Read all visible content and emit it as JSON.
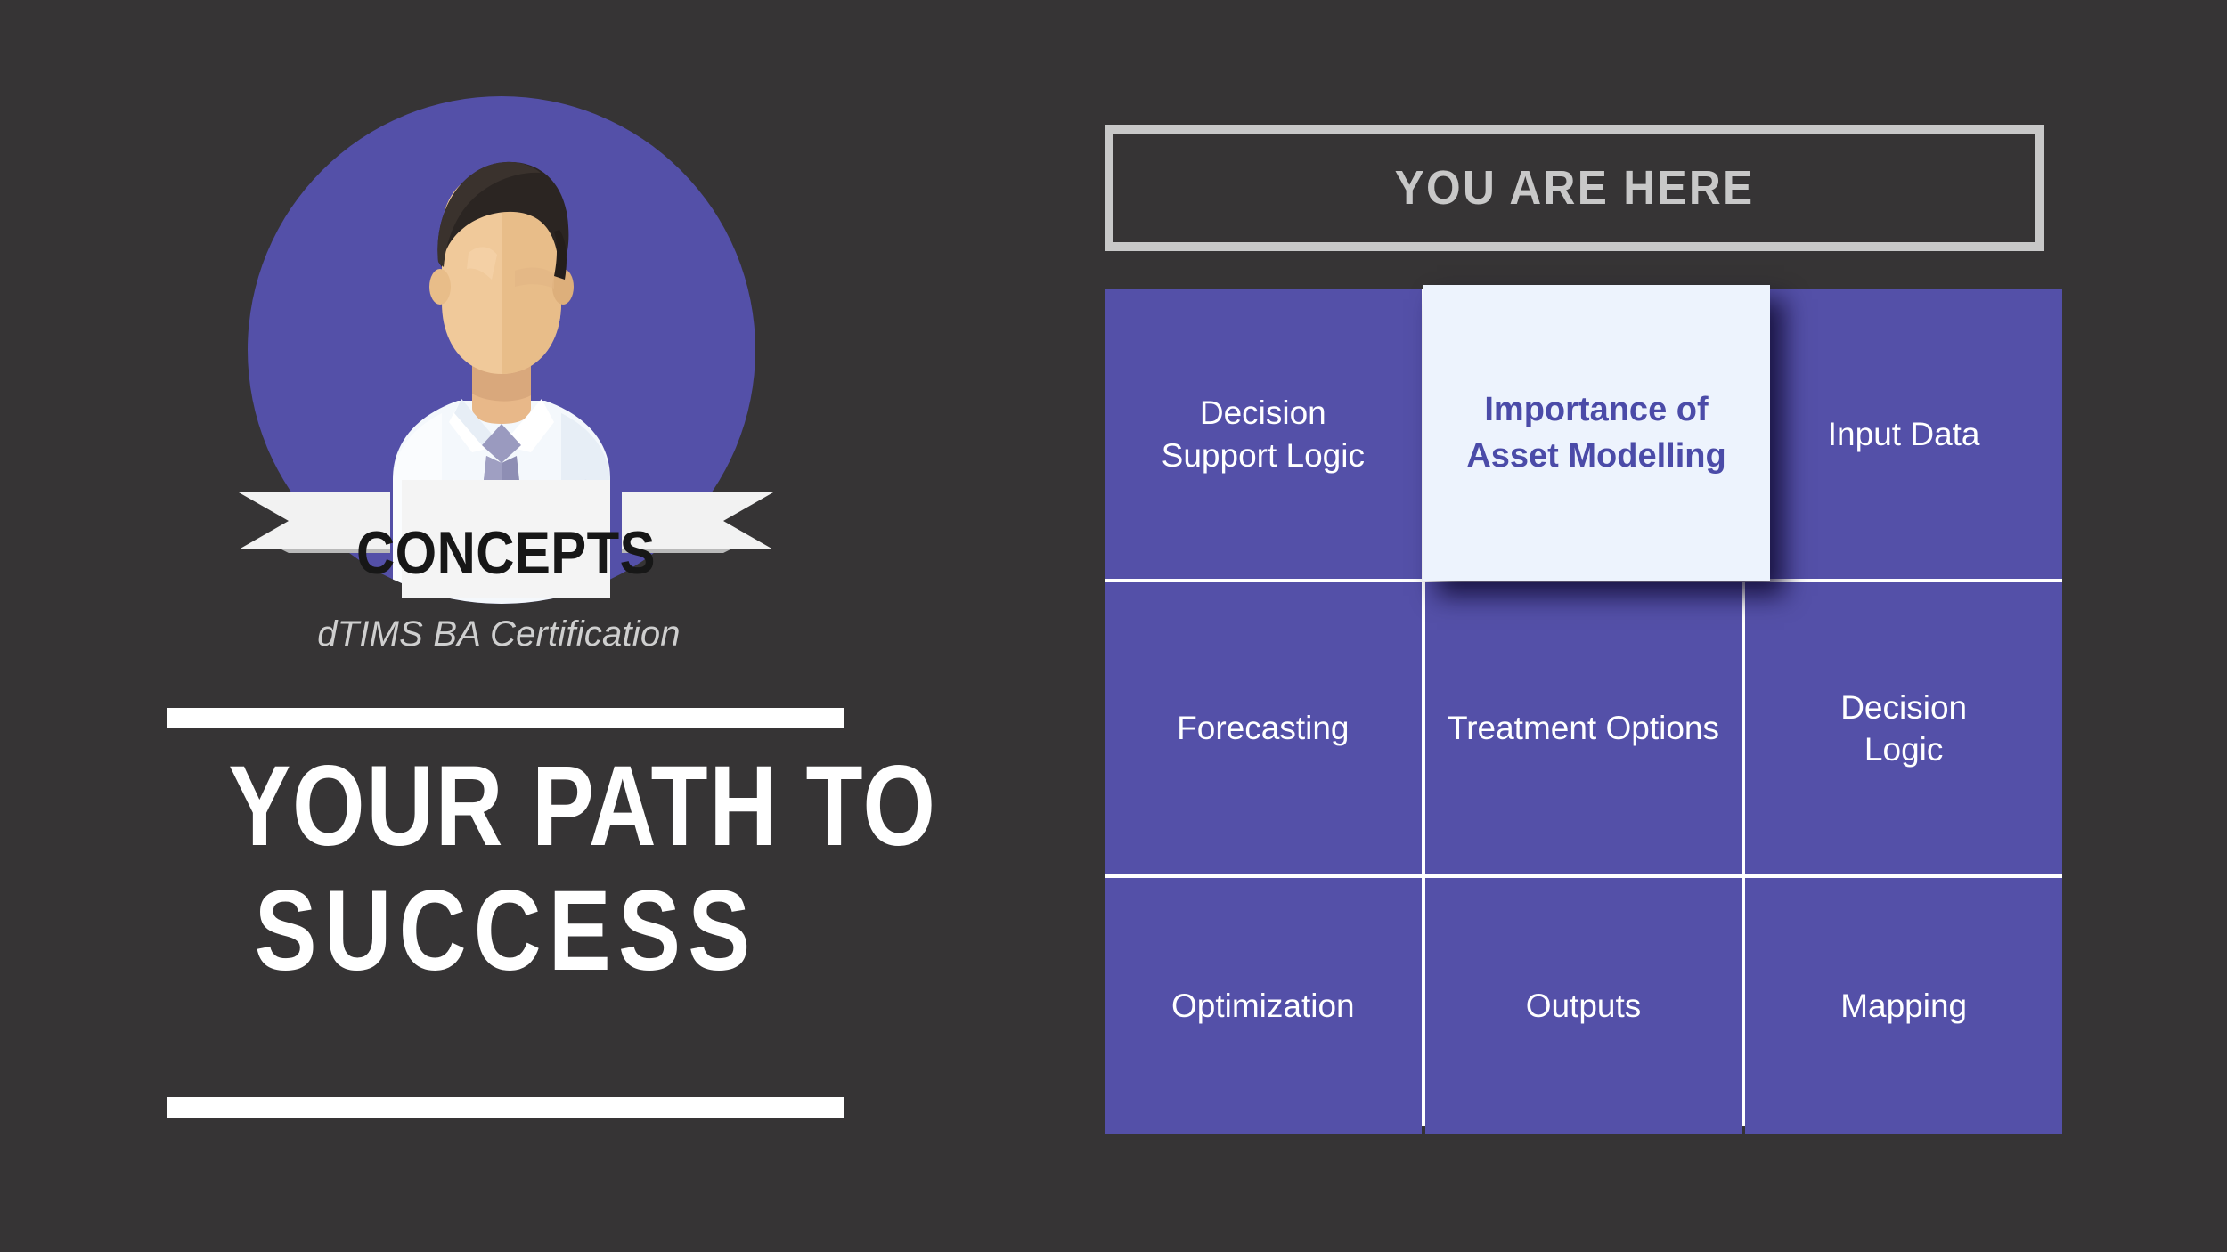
{
  "background_color": "#363435",
  "accent_purple": "#5450A8",
  "highlight_card_bg": "#EDF3FD",
  "highlight_text_color": "#4B4BA8",
  "left": {
    "avatar": {
      "icon": "businessman-avatar-icon",
      "circle_color": "#5450A8",
      "skin_color": "#F0C99A",
      "hair_color": "#2B2522",
      "shirt_color": "#F4F8FC",
      "tie_color": "#8E8EB4"
    },
    "ribbon_label": "CONCEPTS",
    "subtitle": "dTIMS BA Certification",
    "headline_line_1": "YOUR PATH TO",
    "headline_line_2": "SUCCESS"
  },
  "right": {
    "banner_label": "YOU ARE HERE",
    "grid": {
      "rows": [
        [
          {
            "label": "Decision\nSupport Logic",
            "lines": [
              "Decision",
              "Support Logic"
            ],
            "current": false
          },
          {
            "label": "Importance of\nAsset Modelling",
            "lines": [
              "Importance of",
              "Asset Modelling"
            ],
            "current": true
          },
          {
            "label": "Input Data",
            "lines": [
              "Input Data"
            ],
            "current": false
          }
        ],
        [
          {
            "label": "Forecasting",
            "lines": [
              "Forecasting"
            ],
            "current": false
          },
          {
            "label": "Treatment Options",
            "lines": [
              "Treatment Options"
            ],
            "current": false
          },
          {
            "label": "Decision\nLogic",
            "lines": [
              "Decision",
              "Logic"
            ],
            "current": false
          }
        ],
        [
          {
            "label": "Optimization",
            "lines": [
              "Optimization"
            ],
            "current": false
          },
          {
            "label": "Outputs",
            "lines": [
              "Outputs"
            ],
            "current": false
          },
          {
            "label": "Mapping",
            "lines": [
              "Mapping"
            ],
            "current": false
          }
        ]
      ]
    },
    "current_card": {
      "line_1": "Importance of",
      "line_2": "Asset Modelling"
    }
  }
}
